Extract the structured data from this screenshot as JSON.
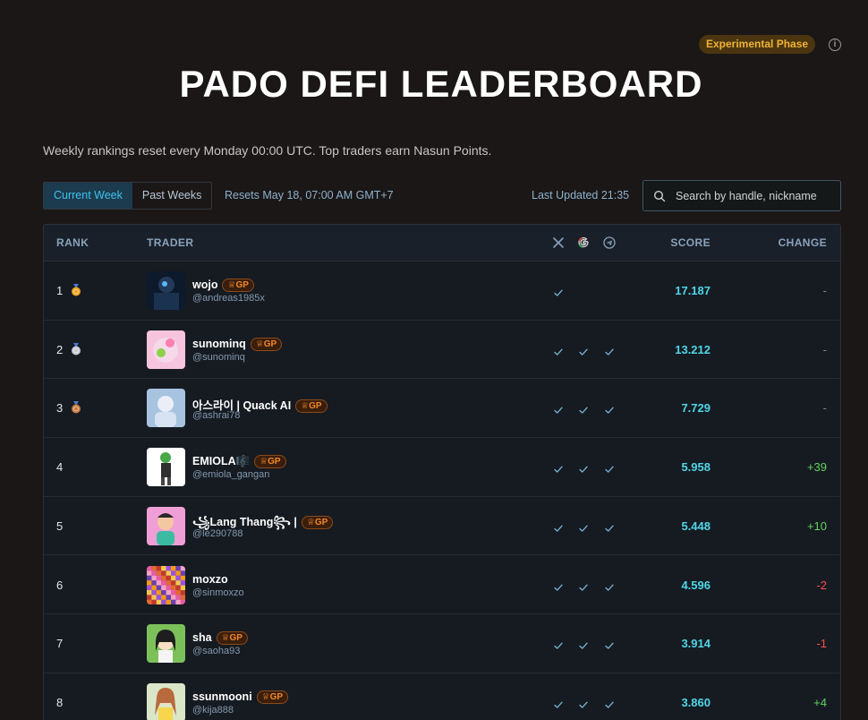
{
  "badge": {
    "label": "Experimental Phase",
    "info_icon": "i"
  },
  "title": "PADO DEFI LEADERBOARD",
  "subtitle": "Weekly rankings reset every Monday 00:00 UTC. Top traders earn Nasun Points.",
  "tabs": [
    {
      "label": "Current Week",
      "active": true
    },
    {
      "label": "Past Weeks",
      "active": false
    }
  ],
  "resets_text": "Resets May 18, 07:00 AM GMT+7",
  "last_updated": "Last Updated 21:35",
  "search": {
    "placeholder": "Search by handle, nickname",
    "value": ""
  },
  "table": {
    "headers": {
      "rank": "RANK",
      "trader": "TRADER",
      "score": "SCORE",
      "change": "CHANGE"
    },
    "social_icons": [
      "x-icon",
      "google-icon",
      "telegram-icon"
    ],
    "rows": [
      {
        "rank": "1",
        "medal": "gold",
        "name": "wojo",
        "gp": "GP",
        "handle": "@andreas1985x",
        "x": true,
        "google": false,
        "telegram": false,
        "score": "17.187",
        "change": "-"
      },
      {
        "rank": "2",
        "medal": "silver",
        "name": "sunominq",
        "gp": "GP",
        "handle": "@sunominq",
        "x": true,
        "google": true,
        "telegram": true,
        "score": "13.212",
        "change": "-"
      },
      {
        "rank": "3",
        "medal": "bronze",
        "name": "아스라이 | Quack AI",
        "gp": "GP",
        "handle": "@ashrai78",
        "x": true,
        "google": true,
        "telegram": true,
        "score": "7.729",
        "change": "-"
      },
      {
        "rank": "4",
        "medal": "",
        "name": "EMIOLA🎼",
        "gp": "GP",
        "handle": "@emiola_gangan",
        "x": true,
        "google": true,
        "telegram": true,
        "score": "5.958",
        "change": "+39"
      },
      {
        "rank": "5",
        "medal": "",
        "name": "꧁Lang Thang꧂ |",
        "gp": "GP",
        "handle": "@le290788",
        "x": true,
        "google": true,
        "telegram": true,
        "score": "5.448",
        "change": "+10"
      },
      {
        "rank": "6",
        "medal": "",
        "name": "moxzo",
        "gp": "",
        "handle": "@sinmoxzo",
        "x": true,
        "google": true,
        "telegram": true,
        "score": "4.596",
        "change": "-2"
      },
      {
        "rank": "7",
        "medal": "",
        "name": "sha",
        "gp": "GP",
        "handle": "@saoha93",
        "x": true,
        "google": true,
        "telegram": true,
        "score": "3.914",
        "change": "-1"
      },
      {
        "rank": "8",
        "medal": "",
        "name": "ssunmooni",
        "gp": "GP",
        "handle": "@kija888",
        "x": true,
        "google": true,
        "telegram": true,
        "score": "3.860",
        "change": "+4"
      }
    ]
  },
  "colors": {
    "background": "#1a1716",
    "accent": "#3ec1ef",
    "score": "#4fd6e6",
    "positive": "#5fd45f",
    "negative": "#ff4d4d",
    "badge_gold": "#f0b335",
    "gp_orange": "#f2872a"
  }
}
